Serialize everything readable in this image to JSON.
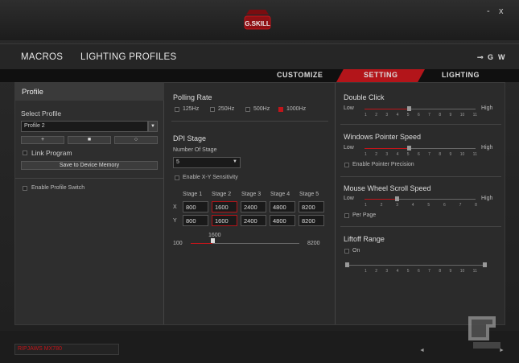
{
  "window": {
    "close": "x",
    "minimize": "-"
  },
  "logo": {
    "text": "G.SKILL"
  },
  "nav": {
    "macros": "MACROS",
    "lighting_profiles": "LIGHTING PROFILES",
    "c": "⊸",
    "g": "G",
    "w": "W"
  },
  "tabs": {
    "customize": "CUSTOMIZE",
    "setting": "SETTING",
    "lighting": "LIGHTING"
  },
  "profile": {
    "header": "Profile",
    "select_label": "Select Profile",
    "selected": "Profile 2",
    "link_program": "Link Program",
    "save_to_memory": "Save to Device Memory",
    "enable_switch": "Enable Profile Switch",
    "btn_add": "+",
    "btn_delete": "■",
    "btn_reset": "○"
  },
  "polling": {
    "title": "Polling Rate",
    "options": [
      "125Hz",
      "250Hz",
      "500Hz",
      "1000Hz"
    ],
    "selected": "1000Hz"
  },
  "dpi": {
    "title": "DPI Stage",
    "num_label": "Number Of Stage",
    "num_value": "5",
    "enable_xy": "Enable X-Y Sensitivity",
    "stages": [
      "Stage 1",
      "Stage 2",
      "Stage 3",
      "Stage 4",
      "Stage 5"
    ],
    "x_label": "X",
    "y_label": "Y",
    "x_values": [
      "800",
      "1600",
      "2400",
      "4800",
      "8200"
    ],
    "y_values": [
      "800",
      "1600",
      "2400",
      "4800",
      "8200"
    ],
    "selected_stage": 2,
    "slider_value": "1600",
    "slider_min": "100",
    "slider_max": "8200"
  },
  "double_click": {
    "title": "Double Click",
    "low": "Low",
    "high": "High",
    "ticks": [
      "1",
      "2",
      "3",
      "4",
      "5",
      "6",
      "7",
      "8",
      "9",
      "10",
      "11"
    ],
    "value": 5
  },
  "pointer_speed": {
    "title": "Windows Pointer Speed",
    "low": "Low",
    "high": "High",
    "ticks": [
      "1",
      "2",
      "3",
      "4",
      "5",
      "6",
      "7",
      "8",
      "9",
      "10",
      "11"
    ],
    "value": 5,
    "precision": "Enable Pointer Precision"
  },
  "scroll_speed": {
    "title": "Mouse Wheel Scroll Speed",
    "low": "Low",
    "high": "High",
    "ticks": [
      "1",
      "2",
      "3",
      "4",
      "5",
      "6",
      "7",
      "8"
    ],
    "value": 3,
    "per_page": "Per Page"
  },
  "liftoff": {
    "title": "Liftoff Range",
    "on": "On",
    "ticks": [
      "1",
      "2",
      "3",
      "4",
      "5",
      "6",
      "7",
      "8",
      "9",
      "10",
      "11"
    ]
  },
  "status": {
    "model": "RIPJAWS MX780",
    "prev": "◄",
    "next": "►"
  }
}
